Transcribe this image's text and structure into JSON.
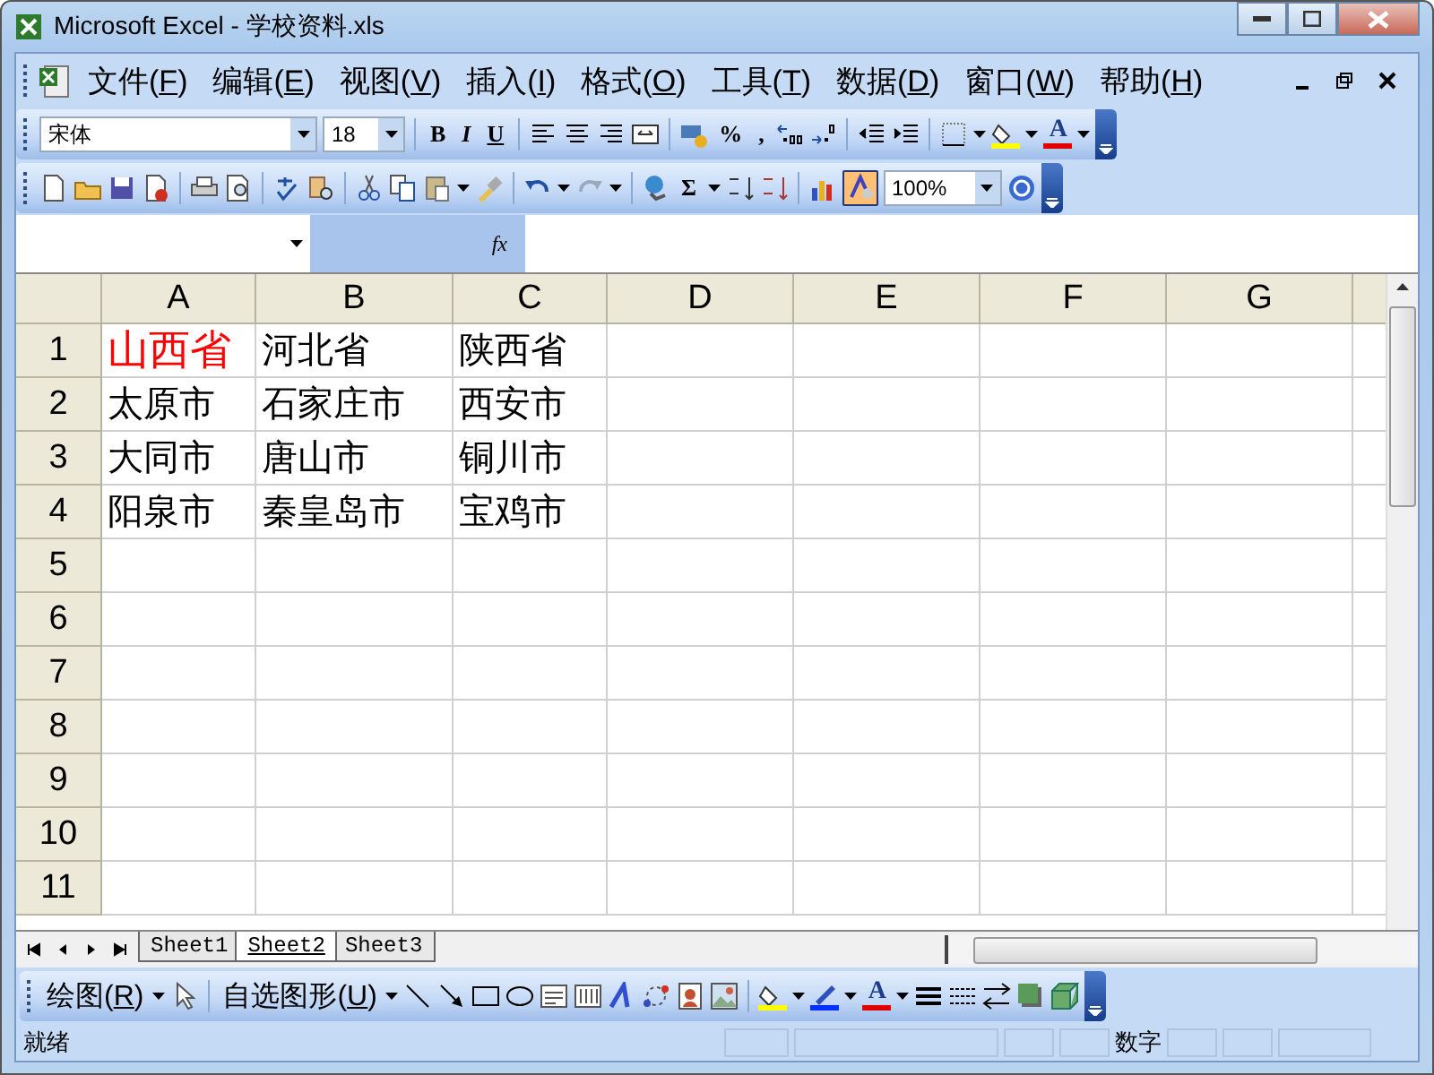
{
  "window": {
    "title": "Microsoft Excel - 学校资料.xls"
  },
  "menu": [
    {
      "label": "文件(",
      "key": "F",
      "tail": ")"
    },
    {
      "label": "编辑(",
      "key": "E",
      "tail": ")"
    },
    {
      "label": "视图(",
      "key": "V",
      "tail": ")"
    },
    {
      "label": "插入(",
      "key": "I",
      "tail": ")"
    },
    {
      "label": "格式(",
      "key": "O",
      "tail": ")"
    },
    {
      "label": "工具(",
      "key": "T",
      "tail": ")"
    },
    {
      "label": "数据(",
      "key": "D",
      "tail": ")"
    },
    {
      "label": "窗口(",
      "key": "W",
      "tail": ")"
    },
    {
      "label": "帮助(",
      "key": "H",
      "tail": ")"
    }
  ],
  "format_toolbar": {
    "font": "宋体",
    "size": "18",
    "bold": "B",
    "italic": "I",
    "underline": "U",
    "percent": "%",
    "comma": ",",
    "font_color": "A"
  },
  "standard_toolbar": {
    "sum": "Σ",
    "zoom": "100%"
  },
  "formula_bar": {
    "fx": "fx"
  },
  "columns": [
    "A",
    "B",
    "C",
    "D",
    "E",
    "F",
    "G"
  ],
  "rows": [
    {
      "header": "1",
      "cells": [
        {
          "text": "山西省",
          "color": "#ff0000"
        },
        {
          "text": "河北省"
        },
        {
          "text": "陕西省"
        }
      ]
    },
    {
      "header": "2",
      "cells": [
        {
          "text": "太原市"
        },
        {
          "text": "石家庄市"
        },
        {
          "text": "西安市"
        }
      ]
    },
    {
      "header": "3",
      "cells": [
        {
          "text": "大同市"
        },
        {
          "text": "唐山市"
        },
        {
          "text": "铜川市"
        }
      ]
    },
    {
      "header": "4",
      "cells": [
        {
          "text": "阳泉市"
        },
        {
          "text": "秦皇岛市"
        },
        {
          "text": "宝鸡市"
        }
      ]
    },
    {
      "header": "5",
      "cells": []
    },
    {
      "header": "6",
      "cells": []
    },
    {
      "header": "7",
      "cells": []
    },
    {
      "header": "8",
      "cells": []
    },
    {
      "header": "9",
      "cells": []
    },
    {
      "header": "10",
      "cells": []
    },
    {
      "header": "11",
      "cells": []
    }
  ],
  "sheet_tabs": [
    {
      "label": "Sheet1",
      "selected": false
    },
    {
      "label": "Sheet2",
      "selected": true
    },
    {
      "label": "Sheet3",
      "selected": false
    }
  ],
  "drawing_toolbar": {
    "draw": {
      "label": "绘图(",
      "key": "R",
      "tail": ")"
    },
    "autoshapes": {
      "label": "自选图形(",
      "key": "U",
      "tail": ")"
    },
    "font_color": "A"
  },
  "status_bar": {
    "status": "就绪",
    "mode": "数字"
  }
}
